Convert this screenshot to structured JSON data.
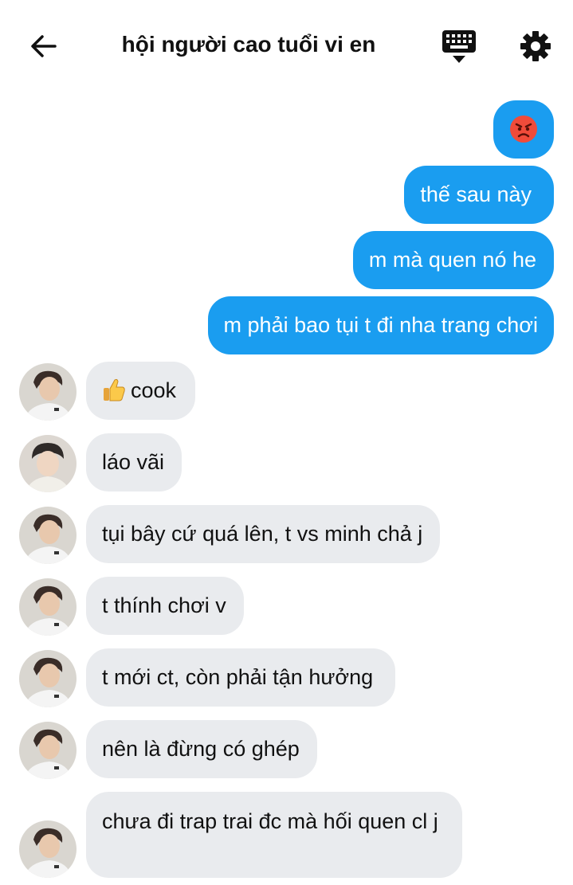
{
  "header": {
    "title": "hội người cao tuổi vi en",
    "back_icon": "arrow-left-icon",
    "keyboard_icon": "keyboard-icon",
    "settings_icon": "gear-icon"
  },
  "colors": {
    "outgoing_bubble": "#1a9df0",
    "incoming_bubble": "#e9ebee"
  },
  "messages": {
    "out": [
      {
        "emoji": "angry-face-emoji"
      },
      {
        "text": "thế sau này"
      },
      {
        "text": "m mà quen nó he"
      },
      {
        "text": "m phải bao tụi t đi nha trang chơi"
      }
    ],
    "in": [
      {
        "emoji": "thumbs-up-emoji",
        "text": "cook"
      },
      {
        "text": "láo vãi"
      },
      {
        "text": "tụi bây cứ quá lên, t vs minh chả j"
      },
      {
        "text": "t thính chơi v"
      },
      {
        "text": "t mới ct, còn phải tận hưởng"
      },
      {
        "text": "nên là đừng có ghép"
      },
      {
        "text": "chưa đi trap trai đc mà hối quen cl j"
      }
    ]
  }
}
